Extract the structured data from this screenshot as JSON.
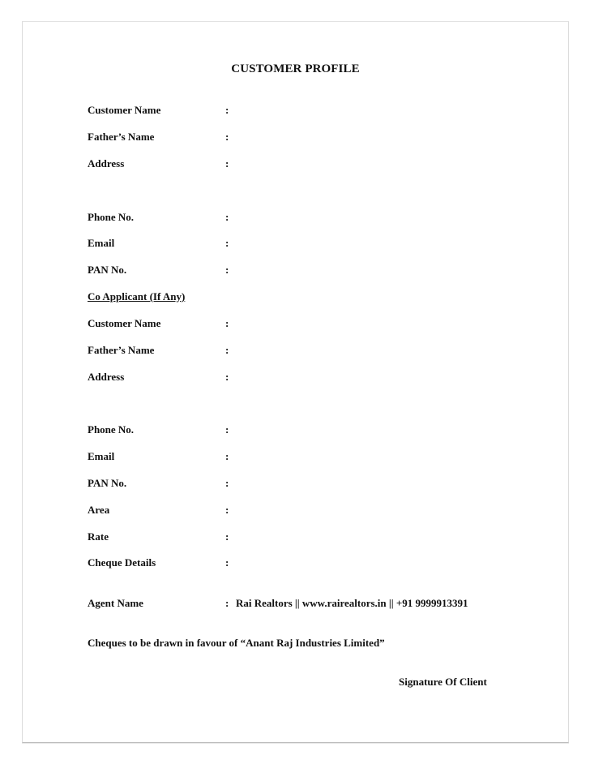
{
  "document": {
    "title": "CUSTOMER PROFILE",
    "customer": {
      "fields": [
        {
          "label": "Customer Name",
          "separator": ":",
          "value": ""
        },
        {
          "label": "Father’s Name",
          "separator": ":",
          "value": ""
        },
        {
          "label": "Address",
          "separator": ":",
          "value": ""
        },
        {
          "label": "Phone No.",
          "separator": ":",
          "value": ""
        },
        {
          "label": "Email",
          "separator": ":",
          "value": ""
        },
        {
          "label": "PAN No.",
          "separator": ":",
          "value": ""
        }
      ]
    },
    "co_applicant": {
      "heading": "Co Applicant (If Any)",
      "fields": [
        {
          "label": "Customer Name",
          "separator": ":",
          "value": ""
        },
        {
          "label": "Father’s Name",
          "separator": ":",
          "value": ""
        },
        {
          "label": "Address",
          "separator": ":",
          "value": ""
        },
        {
          "label": "Phone No.",
          "separator": ":",
          "value": ""
        },
        {
          "label": "Email",
          "separator": ":",
          "value": ""
        },
        {
          "label": "PAN No.",
          "separator": ":",
          "value": ""
        },
        {
          "label": "Area",
          "separator": ":",
          "value": ""
        },
        {
          "label": "Rate",
          "separator": ":",
          "value": ""
        },
        {
          "label": "Cheque Details",
          "separator": ":",
          "value": ""
        }
      ]
    },
    "agent": {
      "label": "Agent Name",
      "separator": ":",
      "value": "Rai Realtors || www.rairealtors.in || +91 9999913391"
    },
    "cheque_note": "Cheques to be drawn in favour of “Anant Raj Industries Limited”",
    "signature_label": "Signature Of Client"
  }
}
